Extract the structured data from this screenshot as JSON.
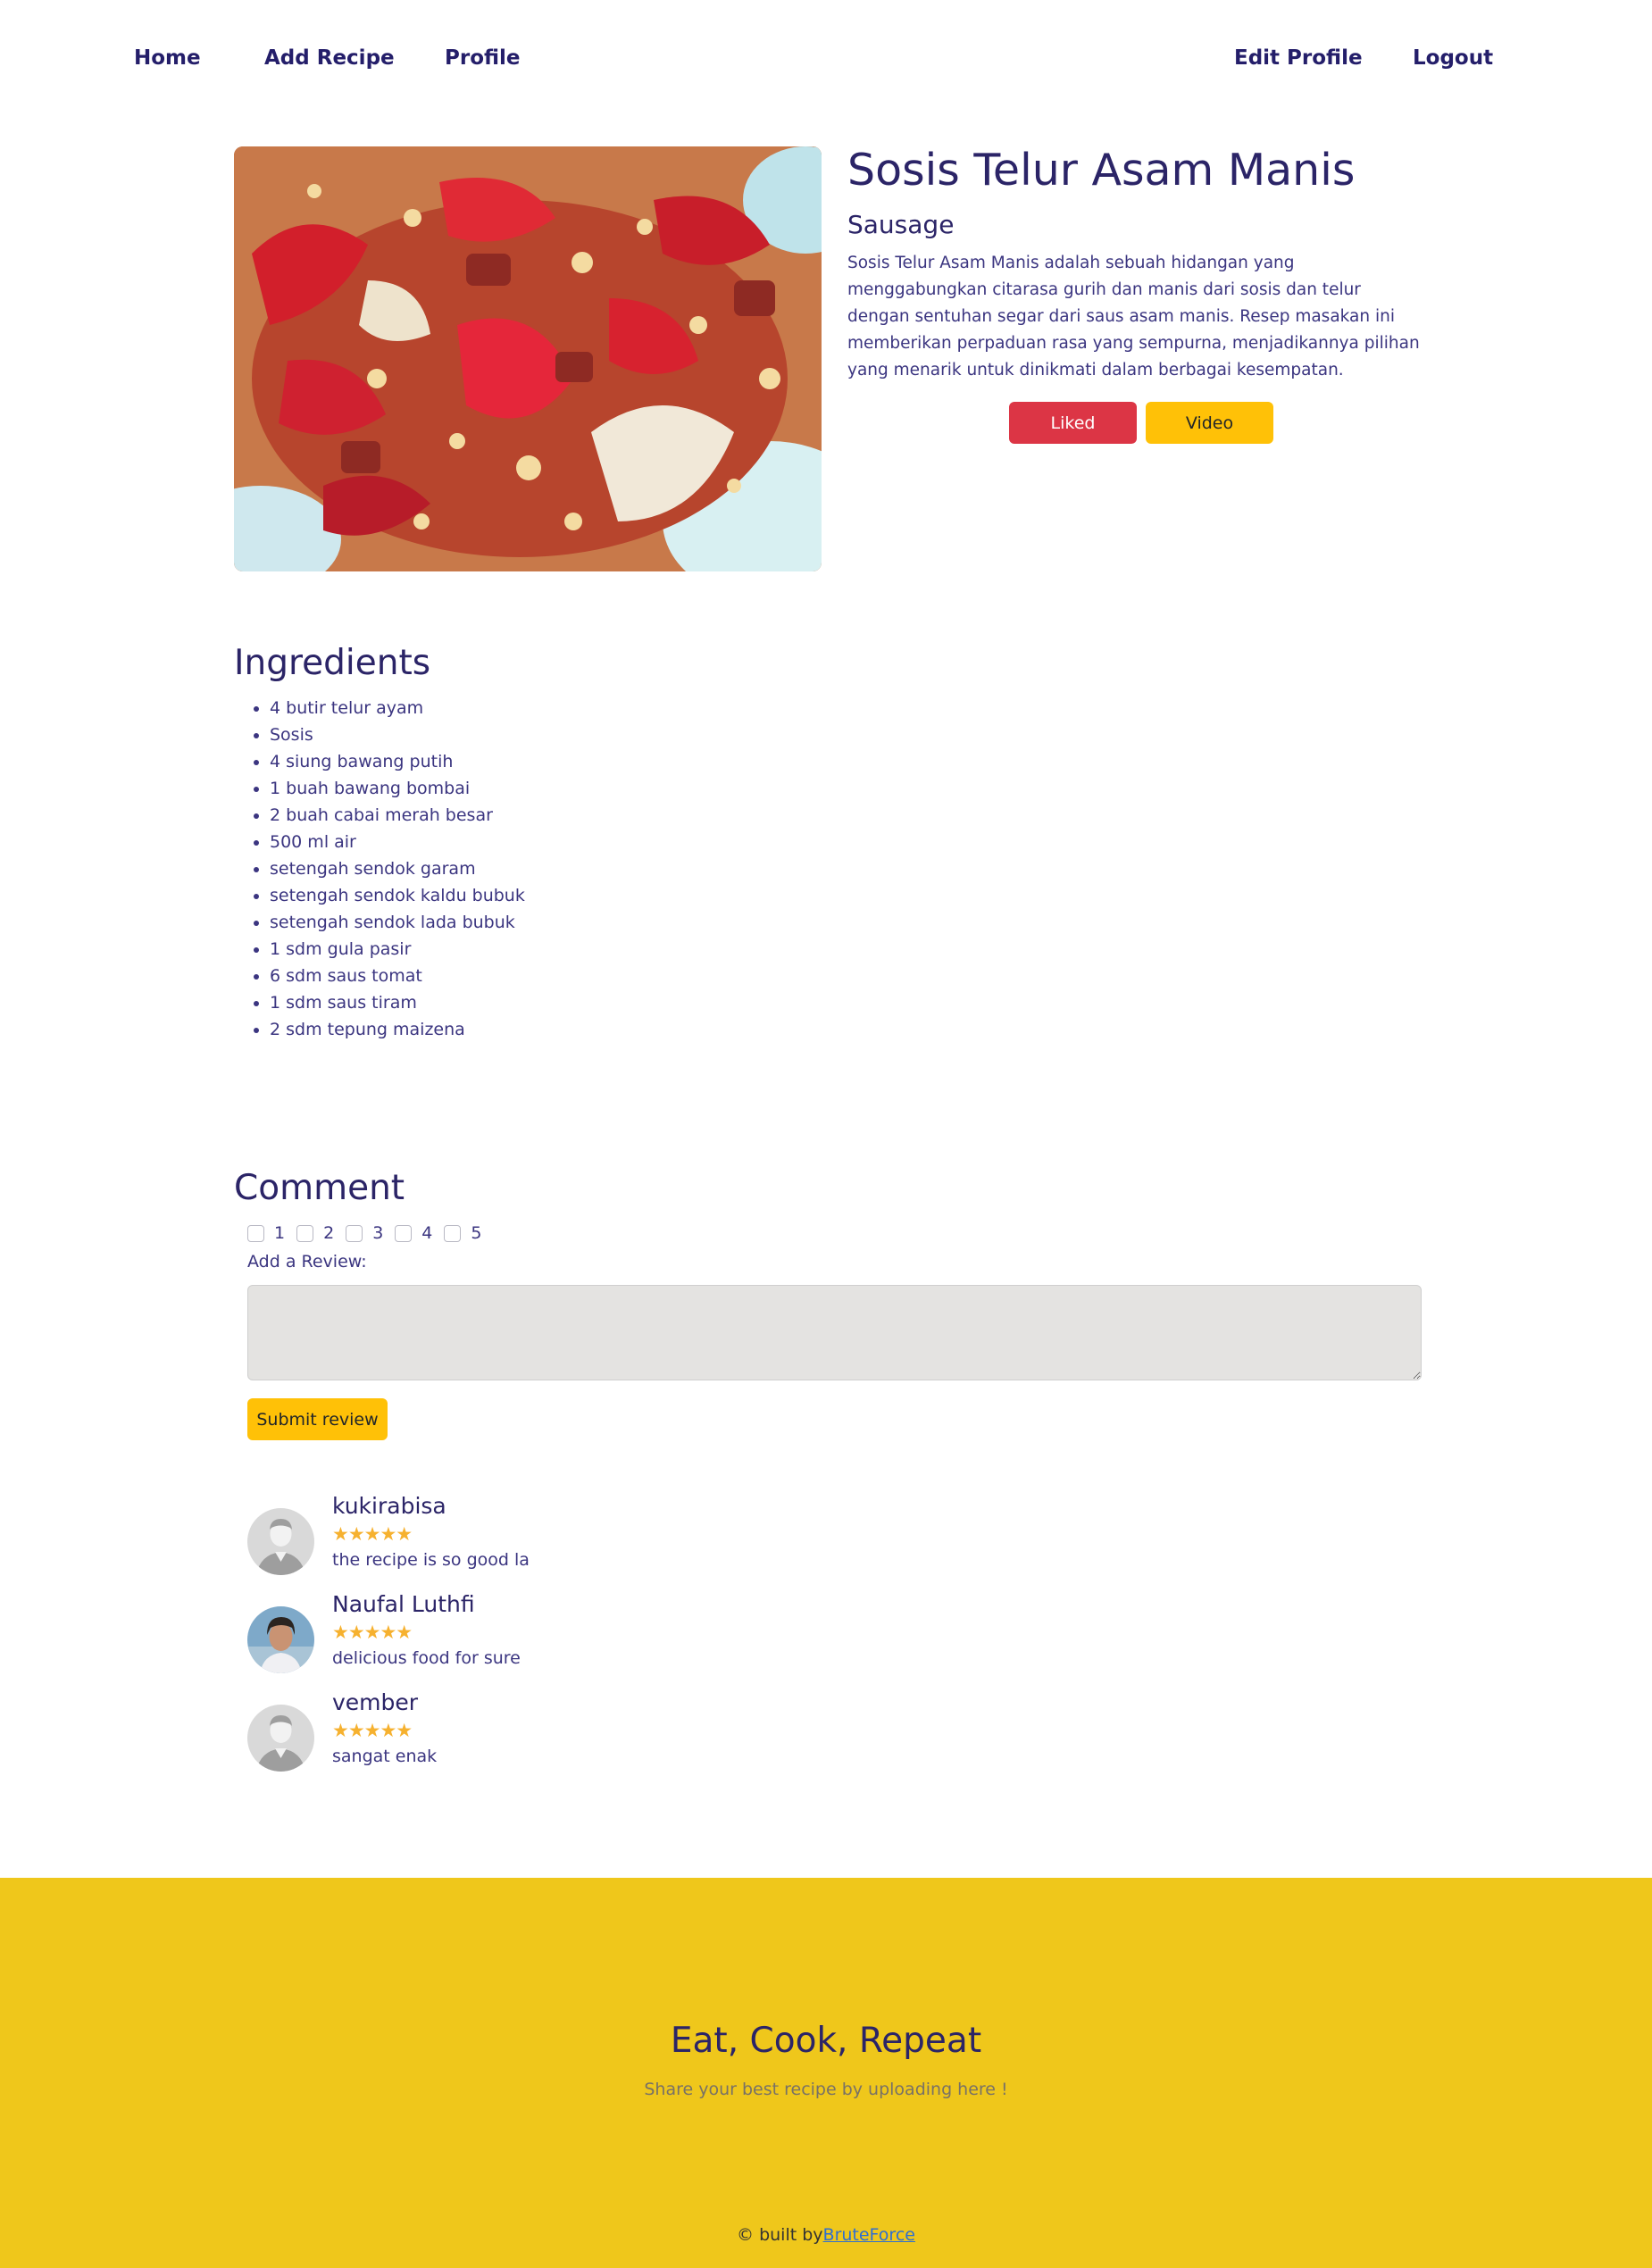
{
  "nav": {
    "home": "Home",
    "add_recipe": "Add Recipe",
    "profile": "Profile",
    "edit_profile": "Edit Profile",
    "logout": "Logout"
  },
  "recipe": {
    "title": "Sosis Telur Asam Manis",
    "category": "Sausage",
    "description": "Sosis Telur Asam Manis adalah sebuah hidangan yang menggabungkan citarasa gurih dan manis dari sosis dan telur dengan sentuhan segar dari saus asam manis. Resep masakan ini memberikan perpaduan rasa yang sempurna, menjadikannya pilihan yang menarik untuk dinikmati dalam berbagai kesempatan.",
    "liked_button": "Liked",
    "video_button": "Video"
  },
  "ingredients": {
    "heading": "Ingredients",
    "items": [
      "4 butir telur ayam",
      "Sosis",
      "4 siung bawang putih",
      "1 buah bawang bombai",
      "2 buah cabai merah besar",
      "500 ml air",
      "setengah sendok garam",
      "setengah sendok kaldu bubuk",
      "setengah sendok lada bubuk",
      "1 sdm gula pasir",
      "6 sdm saus tomat",
      "1 sdm saus tiram",
      "2 sdm tepung maizena"
    ]
  },
  "comment": {
    "heading": "Comment",
    "rating_options": [
      "1",
      "2",
      "3",
      "4",
      "5"
    ],
    "review_label": "Add a Review:",
    "review_value": "",
    "submit_label": "Submit review",
    "list": [
      {
        "name": "kukirabisa",
        "rating": 5,
        "stars": "★★★★★",
        "text": "the recipe is so good la",
        "avatar": "default-avatar"
      },
      {
        "name": "Naufal Luthfi",
        "rating": 5,
        "stars": "★★★★★",
        "text": "delicious food for sure",
        "avatar": "photo-avatar"
      },
      {
        "name": "vember",
        "rating": 5,
        "stars": "★★★★★",
        "text": "sangat enak",
        "avatar": "default-avatar"
      }
    ]
  },
  "footer": {
    "title": "Eat, Cook, Repeat",
    "subtitle": "Share your best recipe by uploading here !",
    "credit_prefix": "© built by",
    "credit_link": "BruteForce"
  },
  "colors": {
    "primary_text": "#2b2467",
    "liked": "#dc3545",
    "video": "#ffc107",
    "footer_bg": "#efc71b",
    "star": "#f6b12f"
  }
}
